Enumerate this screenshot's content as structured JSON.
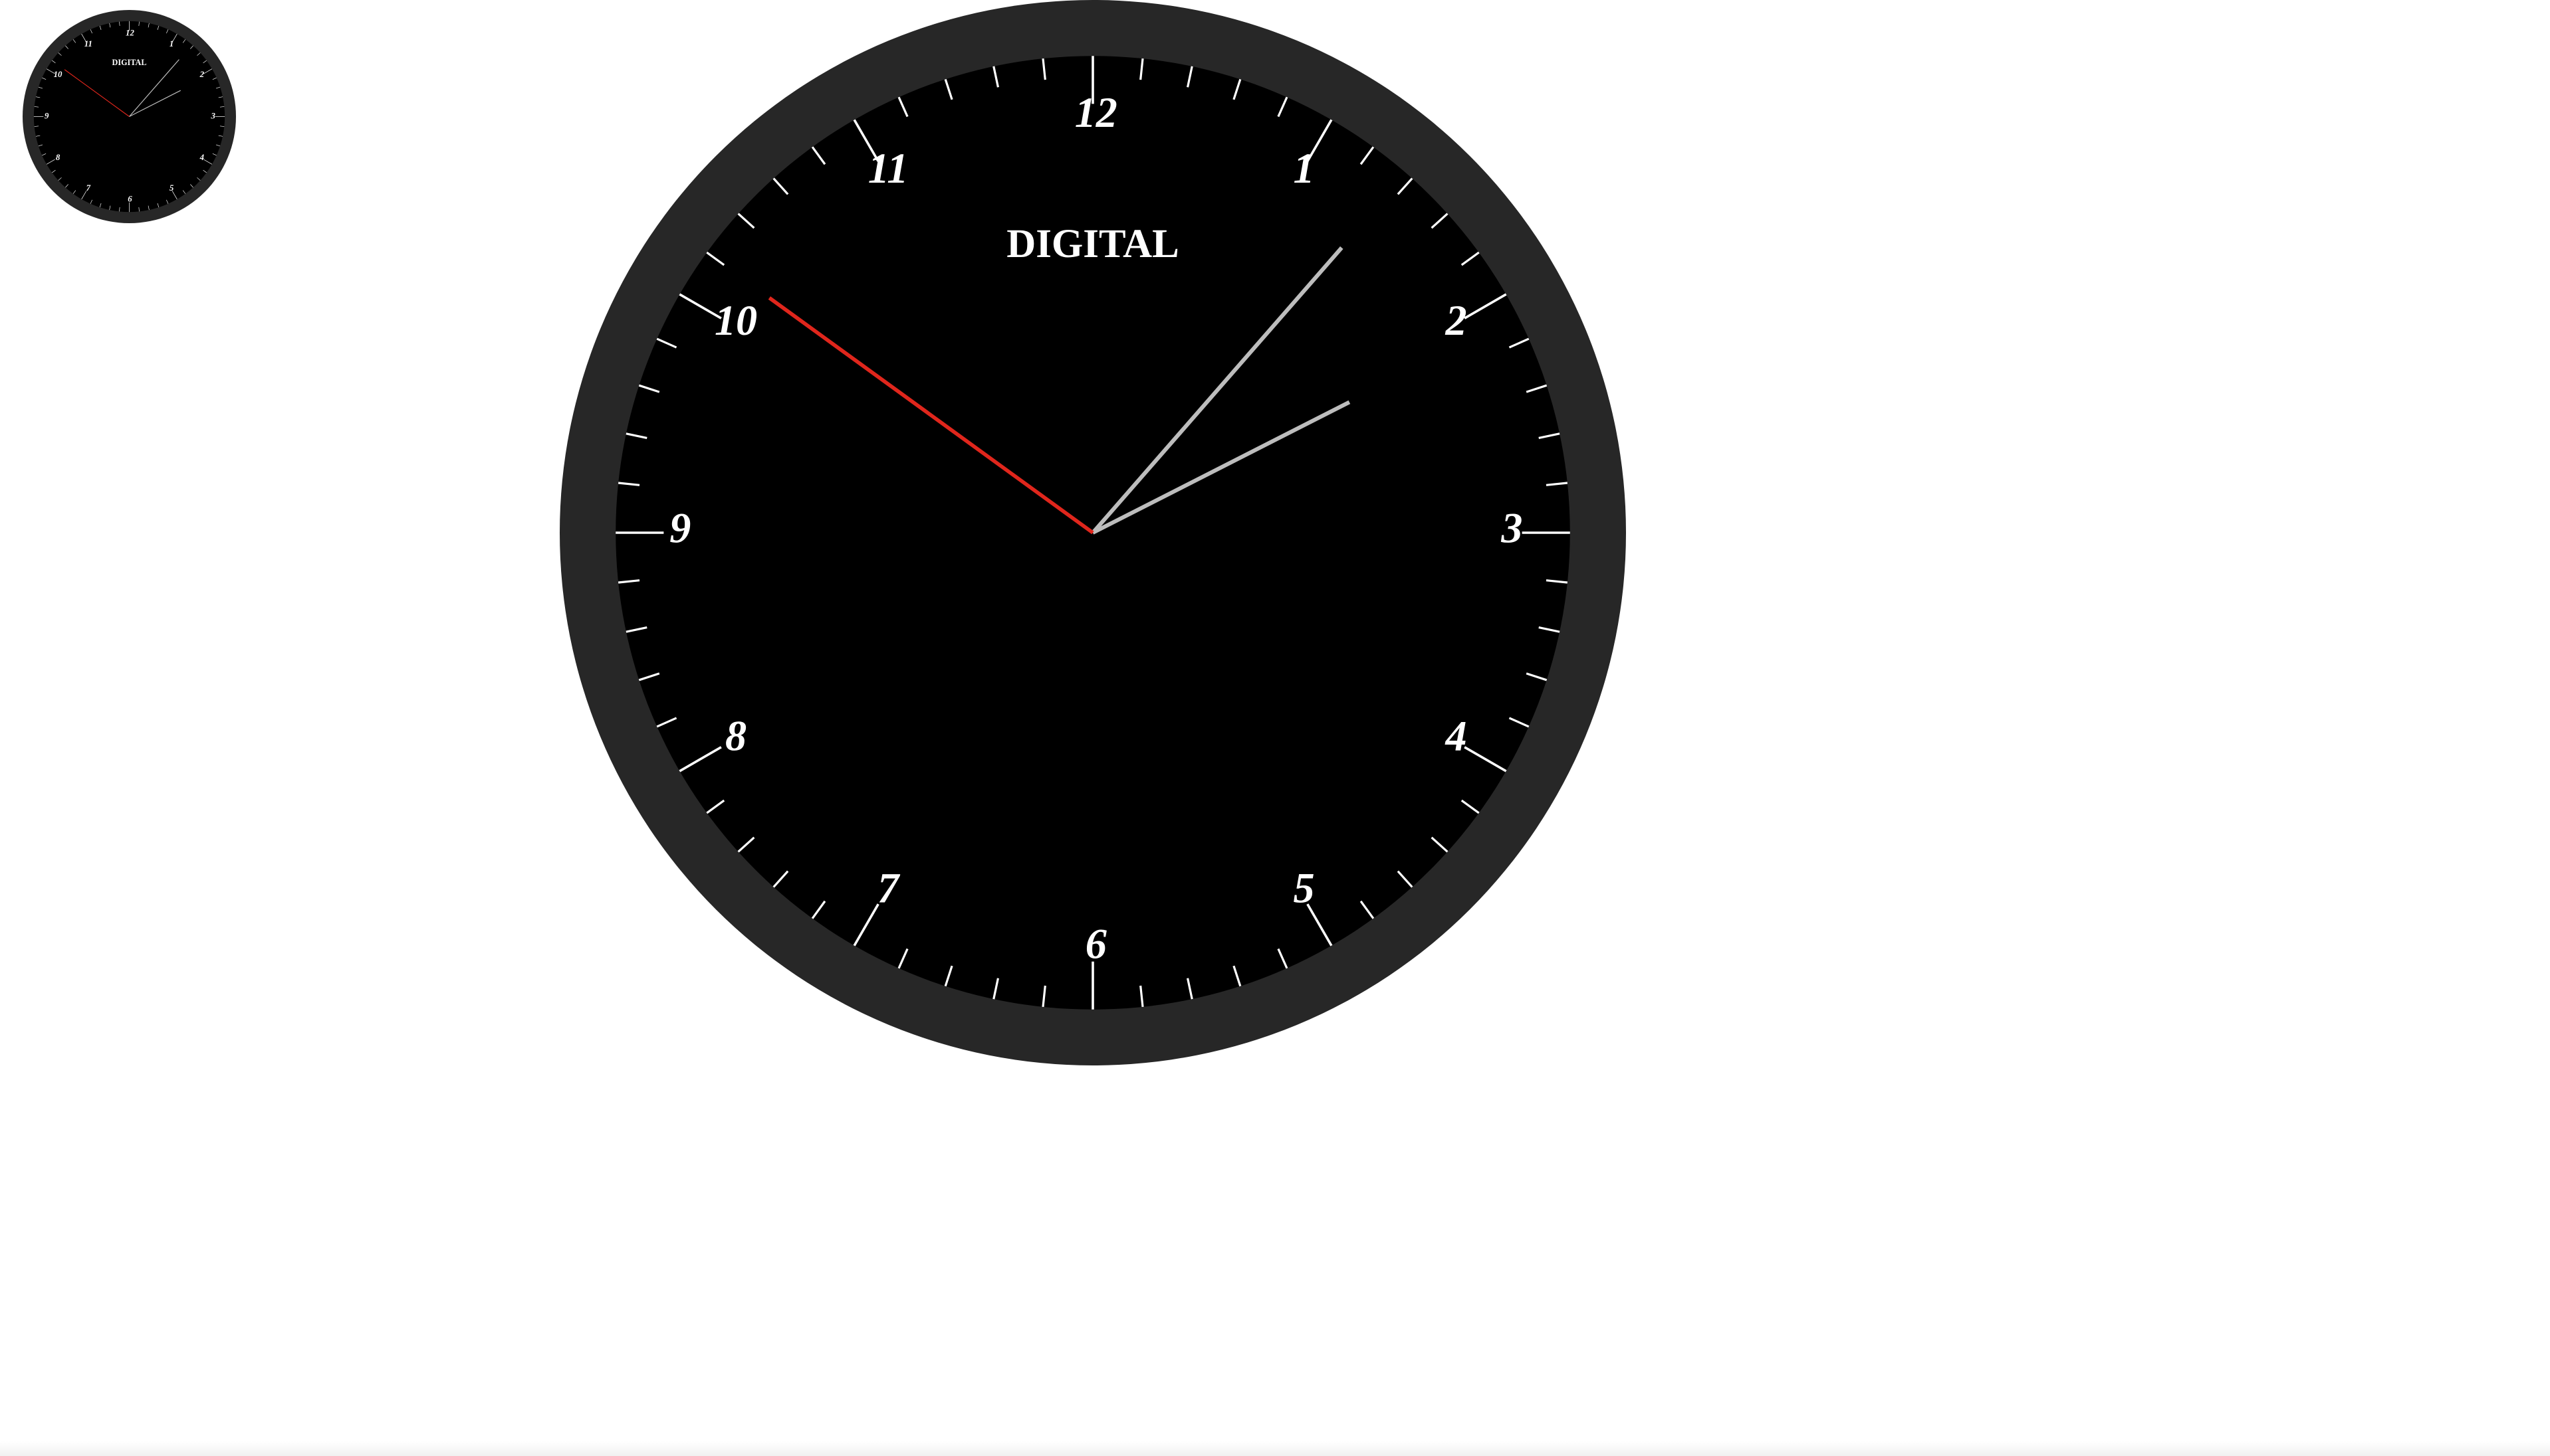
{
  "clock": {
    "brand": "DIGITAL",
    "numerals": [
      "12",
      "1",
      "2",
      "3",
      "4",
      "5",
      "6",
      "7",
      "8",
      "9",
      "10",
      "11"
    ],
    "time": {
      "hour": 2,
      "minute": 6,
      "second": 51
    },
    "colors": {
      "bezel": "#272727",
      "face": "#000000",
      "ticks": "#ffffff",
      "numerals": "#ffffff",
      "brand": "#ffffff",
      "hour_hand": "#bdbdbd",
      "minute_hand": "#bdbdbd",
      "second_hand": "#e0261c"
    }
  }
}
